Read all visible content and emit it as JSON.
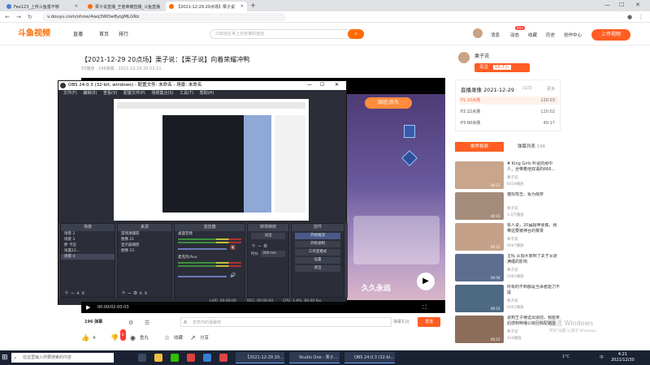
{
  "browser": {
    "tabs": [
      {
        "label": "Fee123_上传斗鱼置不够",
        "active": false,
        "color": "#4b7bd6"
      },
      {
        "label": "栗子说直播_王者荣耀直播_斗鱼直播",
        "active": false,
        "color": "#ff6b00"
      },
      {
        "label": "【2021-12-29 20点场】栗子说",
        "active": true,
        "color": "#ff6b00"
      }
    ],
    "url": "v.douyu.com/show/4wq3WOw8yIgMLGNz"
  },
  "site": {
    "logo": "斗鱼视频",
    "nav": [
      "直播",
      "首页",
      "排行"
    ],
    "search_placeholder": "只知道这世上还有谁的迷途",
    "right_nav": [
      "消息",
      "动态",
      "收藏",
      "历史",
      "创作中心"
    ],
    "upload_label": "上传视频",
    "badge": "99+"
  },
  "video": {
    "title": "【2021-12-29 20点场】栗子说：【栗子说】向着荣耀冲鸭",
    "meta": "53播放  ·  196弹幕  ·  2021-12-29 20:02:11",
    "time": "00:00/02:00:03"
  },
  "anchor": {
    "name": "栗子说",
    "follow_label": "关注",
    "follow_count": "16.7万"
  },
  "recordings": {
    "title": "直播录像 2021-12-29",
    "page": "(1/3)",
    "more": "更多",
    "items": [
      {
        "label": "P1 20点场",
        "duration": "120:03",
        "active": true
      },
      {
        "label": "P2 22点场",
        "duration": "120:02",
        "active": false
      },
      {
        "label": "P3 00点场",
        "duration": "40:17",
        "active": false
      }
    ]
  },
  "hot": {
    "tabs": [
      "推荐视频",
      "弹幕列表"
    ],
    "danmu_count": "196",
    "cards": [
      {
        "title": "# King Girls 听说的那中人，全带着他双语的666...",
        "author": "栗子说",
        "views": "6016播放",
        "duration": "00:15",
        "color": "#c8a58b"
      },
      {
        "title": "猫现攻击，看为哉奈",
        "author": "栗子说",
        "views": "1.4万播放",
        "duration": "00:15",
        "color": "#a58c7a"
      },
      {
        "title": "有人说，20届超神便做，我带这要被神台的赛录",
        "author": "栗子说",
        "views": "9047播放",
        "duration": "00:15",
        "color": "#c6a18a"
      },
      {
        "title": "主吗 从弱大家到了关于写道 满缠的影响",
        "author": "栗子说",
        "views": "1081播放",
        "duration": "00:54",
        "color": "#5c6f8f"
      },
      {
        "title": "所有的不到都是当事者能力不提",
        "author": "栗子说",
        "views": "6062播放",
        "duration": "00:15",
        "color": "#4d6a82"
      },
      {
        "title": "说到王子棱这出道前，我能拿后感到种播公就回我配路话",
        "author": "栗子说",
        "views": "420播放",
        "duration": "00:15",
        "color": "#8c6d5a"
      }
    ]
  },
  "obs": {
    "title": "OBS 24.0.3 (32-bit, windows) - 配置文件: 未命名 - 场景: 未命名",
    "menu": [
      "文件(F)",
      "编辑(E)",
      "查看(V)",
      "配置文件(P)",
      "场景集合(S)",
      "工具(T)",
      "帮助(H)"
    ],
    "docks": {
      "scenes_title": "场景",
      "scenes": [
        "场景 2",
        "场景 3",
        "胖 卡压",
        "早晨12...",
        "场景 4"
      ],
      "sources_title": "来源",
      "sources": [
        "游戏源捕获",
        "图像 21",
        "显示器捕获",
        "图像 23"
      ],
      "mixer_title": "混音器",
      "mixer": [
        "桌面音频",
        "麦克风/Aux"
      ],
      "transition_title": "转场特效",
      "transition_type": "淡出",
      "transition_duration_label": "时长",
      "transition_duration": "300 ms",
      "controls_title": "控件",
      "controls": [
        "开始推流",
        "开始录制",
        "工作室模式",
        "设置",
        "退出"
      ]
    },
    "status": {
      "live": "LIVE: 00:00:00",
      "rec": "REC: 00:00:00",
      "cpu": "CPU: 1.9%, 60.00 fps"
    }
  },
  "stream_overlay": {
    "banner": "国冠:房东",
    "bottom_text": "久久永远"
  },
  "danmu_bar": {
    "placeholder": "发表你的弹幕吧",
    "count_label": "196 弹幕",
    "settings": "弹幕礼仪",
    "send": "发送"
  },
  "actions": {
    "likes": "4",
    "fish": "鱼丸",
    "coins_badge": "0",
    "collect": "收藏",
    "share": "分享"
  },
  "taskbar": {
    "search_placeholder": "在这里输入你要搜索的内容",
    "apps": [
      "【2021-12-29 20...",
      "Studio One - 栗子...",
      "OBS 24.0.3 (32-bi..."
    ],
    "time": "4:21",
    "date": "2021/12/30",
    "weather": "1°C",
    "lang": "中"
  },
  "watermark": {
    "line1": "激活 Windows",
    "line2": "转到\"设置\"以激活 Windows。"
  }
}
